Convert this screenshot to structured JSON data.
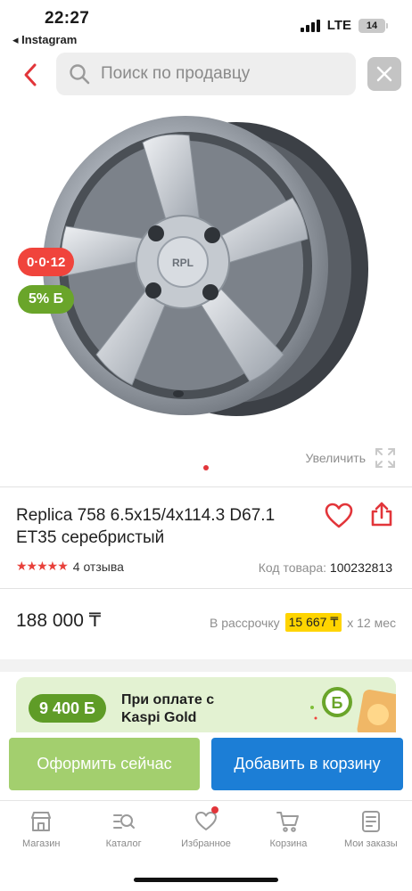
{
  "status_bar": {
    "time": "22:27",
    "back_app": "◂ Instagram",
    "network": "LTE",
    "battery": "14"
  },
  "search": {
    "placeholder": "Поиск по продавцу",
    "back_icon": "chevron-left-icon",
    "search_icon": "search-icon",
    "close_icon": "close-icon"
  },
  "gallery": {
    "badge_installment": "0·0·12",
    "badge_bonus": "5% Б",
    "zoom_label": "Увеличить",
    "image_count": 1,
    "active_index": 0
  },
  "product": {
    "title": "Replica 758 6.5x15/4x114.3 D67.1 ET35 серебристый",
    "stars": 5,
    "reviews": "4 отзыва",
    "code_label": "Код товара:",
    "code_value": "100232813",
    "price": "188 000 ₸",
    "installment_prefix": "В рассрочку",
    "installment_amount": "15 667 ₸",
    "installment_suffix": "x 12 мес"
  },
  "promo": {
    "bonus": "9 400 Б",
    "line1": "При оплате с",
    "line2": "Kaspi Gold"
  },
  "actions": {
    "checkout": "Оформить сейчас",
    "add_to_cart": "Добавить в корзину"
  },
  "nav": [
    {
      "label": "Магазин",
      "icon": "shop-icon"
    },
    {
      "label": "Каталог",
      "icon": "catalog-icon"
    },
    {
      "label": "Избранное",
      "icon": "heart-icon"
    },
    {
      "label": "Корзина",
      "icon": "cart-icon"
    },
    {
      "label": "Мои заказы",
      "icon": "orders-icon"
    }
  ],
  "colors": {
    "accent_red": "#e2353a",
    "green": "#6aa52a",
    "checkout_green": "#a3cf6e",
    "cart_blue": "#1c7ed6",
    "installment_yellow": "#ffd400"
  }
}
